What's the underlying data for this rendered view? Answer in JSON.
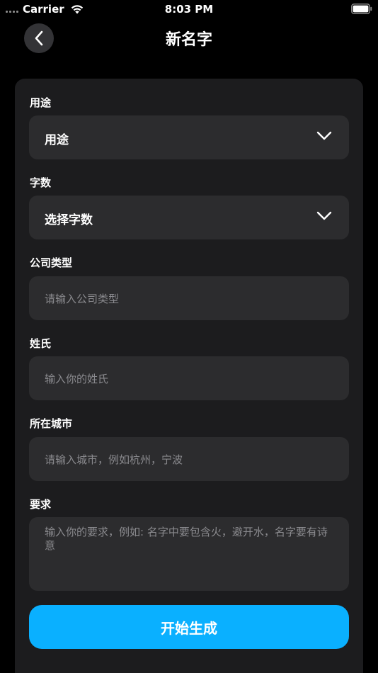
{
  "status_bar": {
    "carrier": "Carrier",
    "time": "8:03 PM"
  },
  "nav": {
    "title": "新名字"
  },
  "form": {
    "purpose": {
      "label": "用途",
      "value": "用途"
    },
    "word_count": {
      "label": "字数",
      "value": "选择字数"
    },
    "company_type": {
      "label": "公司类型",
      "placeholder": "请输入公司类型"
    },
    "surname": {
      "label": "姓氏",
      "placeholder": "输入你的姓氏"
    },
    "city": {
      "label": "所在城市",
      "placeholder": "请输入城市，例如杭州，宁波"
    },
    "requirements": {
      "label": "要求",
      "placeholder": "输入你的要求，例如: 名字中要包含火，避开水，名字要有诗意"
    },
    "submit_label": "开始生成"
  },
  "colors": {
    "accent": "#0ab0ff",
    "card": "#1c1c1e",
    "field": "#2c2c2e"
  }
}
